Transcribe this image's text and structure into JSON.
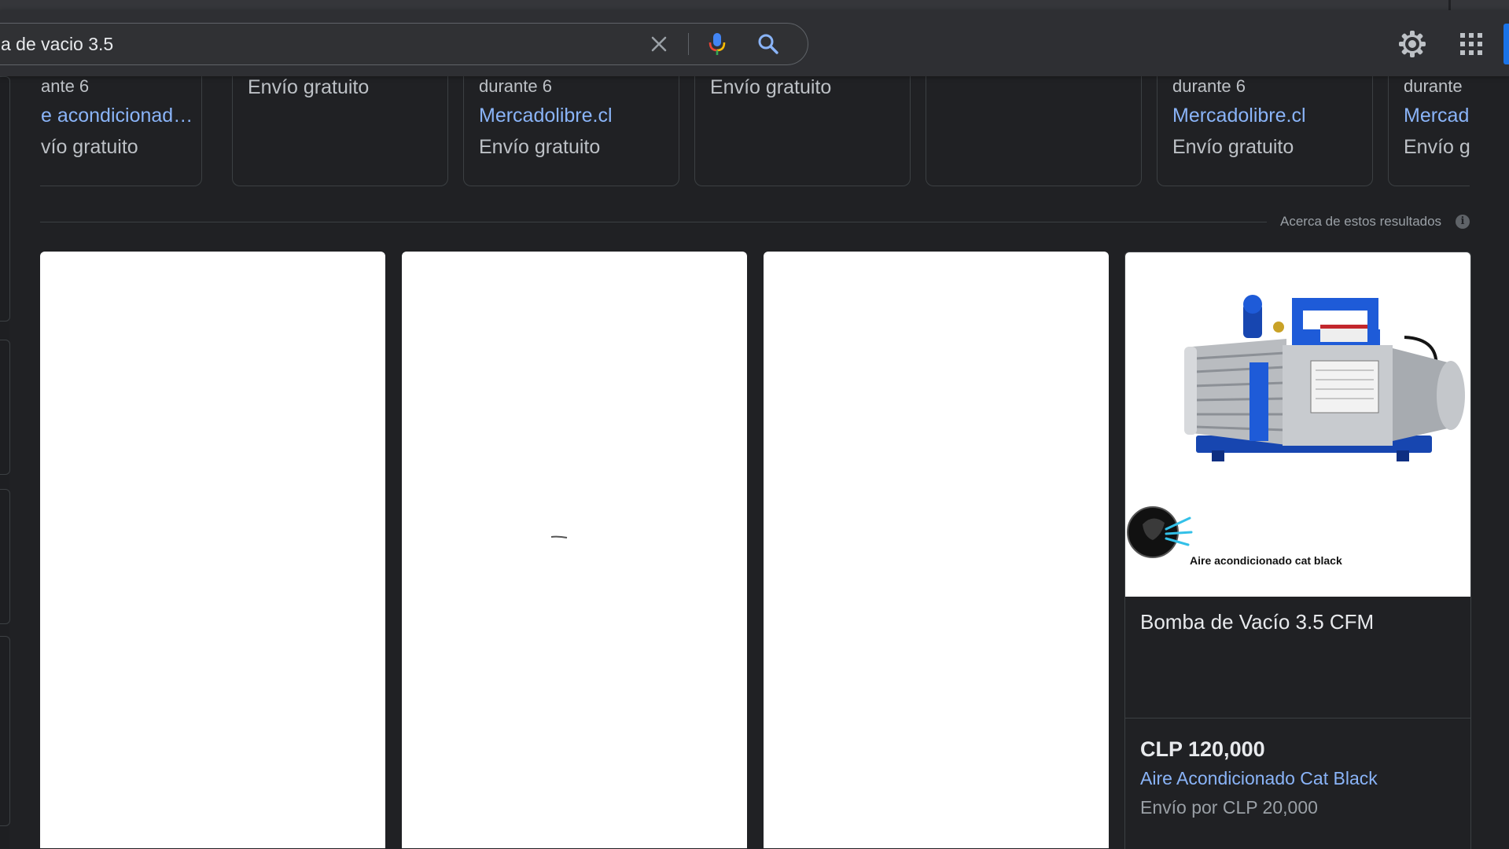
{
  "search": {
    "query": "a de vacio 3.5"
  },
  "icons": {
    "clear": "close-icon",
    "mic": "microphone-icon",
    "lens": "search-icon",
    "settings": "gear-icon",
    "apps": "apps-grid-icon",
    "info": "info-icon"
  },
  "colors": {
    "link": "#8ab4f8",
    "accent": "#1a73e8",
    "background": "#202124"
  },
  "shopping_strip": [
    {
      "line1": "ante 6",
      "line2": "e acondicionad…",
      "line3": "vío gratuito"
    },
    {
      "line1": "Envío gratuito"
    },
    {
      "line1": "durante 6",
      "line2": "Mercadolibre.cl",
      "line3": "Envío gratuito"
    },
    {
      "line1": "Envío gratuito"
    },
    {},
    {
      "line1": "durante 6",
      "line2": "Mercadolibre.cl",
      "line3": "Envío gratuito"
    },
    {
      "line1": "durante",
      "line2": "Mercad",
      "line3": "Envío g"
    }
  ],
  "about_results": "Acerca de estos resultados",
  "info_glyph": "i",
  "product": {
    "title": "Bomba de Vacío 3.5 CFM",
    "price": "CLP 120,000",
    "seller": "Aire Acondicionado Cat Black",
    "shipping": "Envío por CLP 20,000",
    "image_caption": "Aire acondicionado cat black"
  }
}
